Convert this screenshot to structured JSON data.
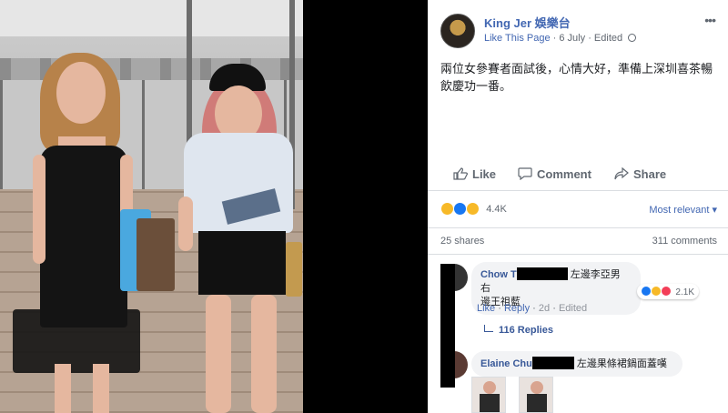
{
  "post": {
    "page_name": "King Jer 娛樂台",
    "like_page": "Like This Page",
    "date": "6 July",
    "edited": "Edited",
    "text": "兩位女參賽者面試後，心情大好，準備上深圳喜茶暢飲慶功一番。"
  },
  "actions": {
    "like": "Like",
    "comment": "Comment",
    "share": "Share"
  },
  "reactions": {
    "count": "4.4K",
    "sort": "Most relevant ▾",
    "shares": "25 shares",
    "comments": "311 comments"
  },
  "comments": [
    {
      "name": "Chow T",
      "text_line1": "左邊李亞男 右",
      "text_line2": "邊王祖藍",
      "reaction_count": "2.1K",
      "like": "Like",
      "reply": "Reply",
      "time": "2d",
      "edited": "Edited",
      "replies": "116 Replies"
    },
    {
      "name": "Elaine Chu",
      "text": "左邊果條裙鍋面蓋嘆"
    }
  ],
  "colors": {
    "link": "#4267b2",
    "like_blue": "#1877f2",
    "haha_yellow": "#f7b928",
    "love_red": "#f33e58"
  }
}
